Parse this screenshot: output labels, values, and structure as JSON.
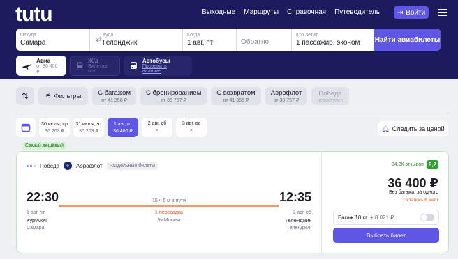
{
  "header": {
    "logo": "tutu",
    "nav": [
      "Выходные",
      "Маршруты",
      "Справочная",
      "Путеводитель"
    ],
    "login_label": "Войти"
  },
  "search": {
    "from": {
      "label": "Откуда",
      "value": "Самара"
    },
    "to": {
      "label": "Куда",
      "value": "Геленджик"
    },
    "when": {
      "label": "Когда",
      "value": "1 авг, пт"
    },
    "back": {
      "placeholder": "Обратно"
    },
    "passengers": {
      "label": "Кто летит",
      "value": "1 пассажир, эконом"
    },
    "submit_label": "Найти авиабилеты"
  },
  "modes": [
    {
      "title": "Авиа",
      "subtitle": "от 36 400 ₽",
      "icon": "plane-icon"
    },
    {
      "title": "Ж/д",
      "subtitle": "Билетов нет",
      "icon": "train-icon"
    },
    {
      "title": "Автобусы",
      "subtitle": "Проверить наличие",
      "icon": "bus-icon"
    }
  ],
  "filters": {
    "filters_label": "Фильтры",
    "chips": [
      {
        "title": "С багажом",
        "sub": "от 41 358 ₽"
      },
      {
        "title": "С бронированием",
        "sub": "от 36 757 ₽"
      },
      {
        "title": "С возвратом",
        "sub": "от 41 358 ₽"
      },
      {
        "title": "Аэрофлот",
        "sub": "от 36 757 ₽"
      },
      {
        "title": "Победа",
        "sub": "недоступен"
      }
    ]
  },
  "dates": [
    {
      "day": "30 июля, ср",
      "price": "36 203 ₽"
    },
    {
      "day": "31 июля, чт",
      "price": "36 203 ₽"
    },
    {
      "day": "1 авг, пт",
      "price": "36 400 ₽"
    },
    {
      "day": "2 авг, сб",
      "price": "⌕"
    },
    {
      "day": "3 авг, вс",
      "price": "⌕"
    }
  ],
  "watch_label": "Следить за ценой",
  "cheapest_badge": "Самый дешёвый",
  "ticket": {
    "airline1": "Победа",
    "airline2": "Аэрофлот",
    "separate_badge": "Раздельные билеты",
    "dep_time": "22:30",
    "arr_time": "12:35",
    "duration": "15 ч 5 м в пути",
    "dep_date": "1 авг, пт",
    "arr_date": "2 авг, сб",
    "transfer": "1 пересадка",
    "transfer_detail": "9ч Москва",
    "dep_airport": "Курумоч",
    "dep_city": "Самара",
    "arr_airport": "Геленджик",
    "arr_city": "Геленджик",
    "reviews": "34,2К отзывов",
    "rating": "8,2",
    "price": "36 400 ₽",
    "baggage_note": "Без багажа, за одного",
    "seats_left": "Осталось 6 мест",
    "bag_option": "Багаж 10 кг",
    "bag_price": "+ 8 021 ₽",
    "choose_label": "Выбрать билет"
  }
}
